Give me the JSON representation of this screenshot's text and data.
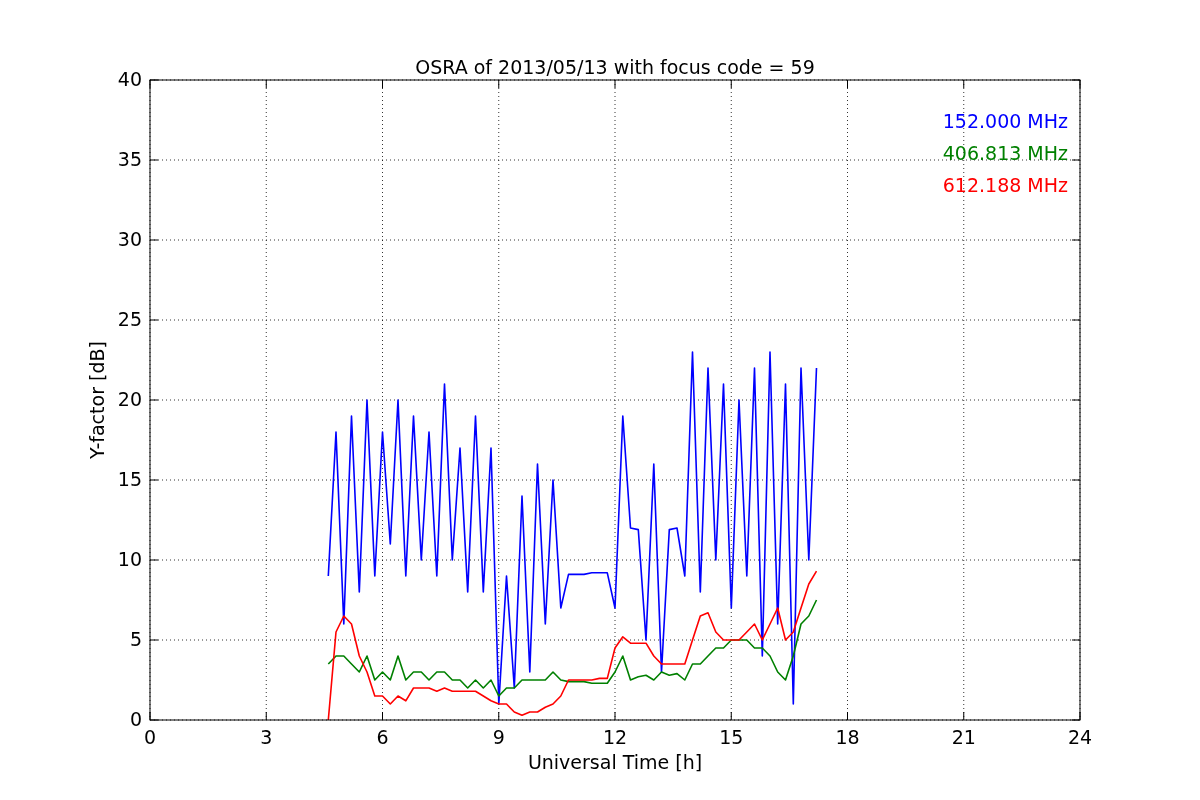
{
  "chart_data": {
    "type": "line",
    "title": "OSRA of 2013/05/13 with focus code = 59",
    "xlabel": "Universal Time [h]",
    "ylabel": "Y-factor [dB]",
    "xlim": [
      0,
      24
    ],
    "ylim": [
      0,
      40
    ],
    "xticks": [
      0,
      3,
      6,
      9,
      12,
      15,
      18,
      21,
      24
    ],
    "yticks": [
      0,
      5,
      10,
      15,
      20,
      25,
      30,
      35,
      40
    ],
    "grid": true,
    "x": [
      4.6,
      4.8,
      5.0,
      5.2,
      5.4,
      5.6,
      5.8,
      6.0,
      6.2,
      6.4,
      6.6,
      6.8,
      7.0,
      7.2,
      7.4,
      7.6,
      7.8,
      8.0,
      8.2,
      8.4,
      8.6,
      8.8,
      9.0,
      9.2,
      9.4,
      9.6,
      9.8,
      10.0,
      10.2,
      10.4,
      10.6,
      10.8,
      11.0,
      11.2,
      11.4,
      11.6,
      11.8,
      12.0,
      12.2,
      12.4,
      12.6,
      12.8,
      13.0,
      13.2,
      13.4,
      13.6,
      13.8,
      14.0,
      14.2,
      14.4,
      14.6,
      14.8,
      15.0,
      15.2,
      15.4,
      15.6,
      15.8,
      16.0,
      16.2,
      16.4,
      16.6,
      16.8,
      17.0,
      17.2
    ],
    "series": [
      {
        "name": "152.000 MHz",
        "color": "#0000ff",
        "values": [
          9,
          18,
          6,
          19,
          8,
          20,
          9,
          18,
          11,
          20,
          9,
          19,
          10,
          18,
          9,
          21,
          10,
          17,
          8,
          19,
          8,
          17,
          1,
          9,
          2,
          14,
          3,
          16,
          6,
          15,
          7,
          9.1,
          9.1,
          9.1,
          9.2,
          9.2,
          9.2,
          7,
          19,
          12,
          11.9,
          5,
          16,
          3,
          11.9,
          12,
          9,
          23,
          8,
          22,
          10,
          21,
          7,
          20,
          9,
          22,
          4,
          23,
          6,
          21,
          1,
          22,
          10,
          22
        ]
      },
      {
        "name": "406.813 MHz",
        "color": "#008000",
        "values": [
          3.5,
          4,
          4,
          3.5,
          3,
          4,
          2.5,
          3,
          2.5,
          4,
          2.5,
          3,
          3,
          2.5,
          3,
          3,
          2.5,
          2.5,
          2,
          2.5,
          2,
          2.5,
          1.5,
          2,
          2,
          2.5,
          2.5,
          2.5,
          2.5,
          3,
          2.5,
          2.4,
          2.4,
          2.4,
          2.3,
          2.3,
          2.3,
          3,
          4,
          2.5,
          2.7,
          2.8,
          2.5,
          3,
          2.8,
          2.9,
          2.5,
          3.5,
          3.5,
          4,
          4.5,
          4.5,
          5,
          5,
          5,
          4.5,
          4.5,
          4,
          3,
          2.5,
          4,
          6,
          6.5,
          7.5
        ]
      },
      {
        "name": "612.188 MHz",
        "color": "#ff0000",
        "values": [
          0,
          5.5,
          6.5,
          6,
          4,
          3,
          1.5,
          1.5,
          1,
          1.5,
          1.2,
          2,
          2,
          2,
          1.8,
          2,
          1.8,
          1.8,
          1.8,
          1.8,
          1.5,
          1.2,
          1,
          1,
          0.5,
          0.3,
          0.5,
          0.5,
          0.8,
          1,
          1.5,
          2.5,
          2.5,
          2.5,
          2.5,
          2.6,
          2.6,
          4.5,
          5.2,
          4.8,
          4.8,
          4.8,
          4,
          3.5,
          3.5,
          3.5,
          3.5,
          5,
          6.5,
          6.7,
          5.5,
          5,
          5,
          5,
          5.5,
          6,
          5,
          6,
          7,
          5,
          5.5,
          7,
          8.5,
          9.3
        ]
      }
    ]
  }
}
